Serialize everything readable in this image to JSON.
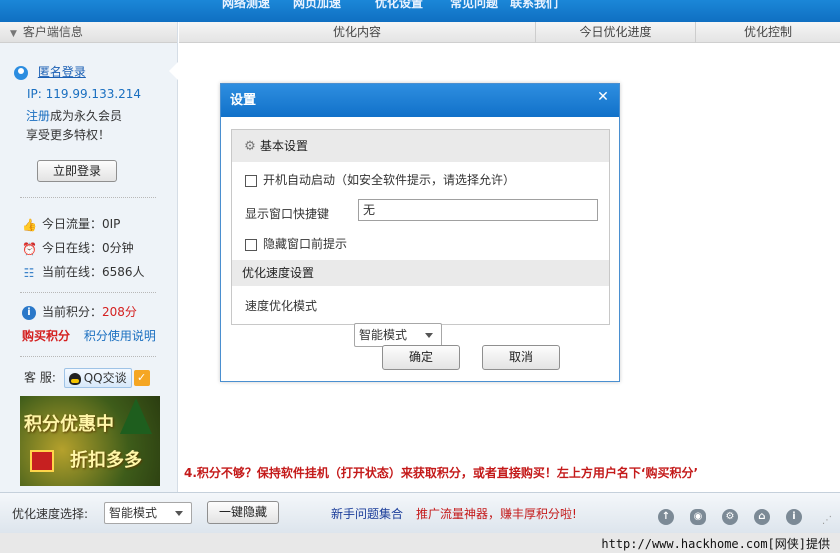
{
  "top_menu": [
    "网络测速",
    "网页加速",
    "优化设置",
    "常见问题",
    "联系我们"
  ],
  "sidebar": {
    "header": "客户端信息",
    "anon_login": "匿名登录",
    "ip": "IP: 119.99.133.214",
    "register_link": "注册",
    "register_text": "成为永久会员",
    "privilege_text": "享受更多特权！",
    "login_button": "立即登录",
    "traffic": "今日流量：0IP",
    "online_time": "今日在线：0分钟",
    "current_online": "当前在线：6586人",
    "points_label": "当前积分：",
    "points_value": "208分",
    "buy_points": "购买积分",
    "points_help": "积分使用说明",
    "service_label": "客 服:",
    "qq_label": "QQ交谈",
    "banner_line1": "积分优惠中",
    "banner_line2": "折扣多多"
  },
  "table_header": {
    "content": "优化内容",
    "progress": "今日优化进度",
    "control": "优化控制"
  },
  "tip": "4.积分不够？保持软件挂机（打开状态）来获取积分，或者直接购买！左上方用户名下‘购买积分’",
  "bottom": {
    "speed_label": "优化速度选择:",
    "speed_value": "智能模式",
    "hide_button": "一键隐藏",
    "faq_link": "新手问题集合",
    "promo_link": "推广流量神器，赚丰厚积分啦!"
  },
  "watermark": "http://www.hackhome.com[网侠]提供",
  "dialog": {
    "title": "设置",
    "close": "✕",
    "basic_section": "基本设置",
    "autostart_label": "开机自动启动（如安全软件提示，请选择允许）",
    "autostart_checked": false,
    "hotkey_label": "显示窗口快捷键",
    "hotkey_value": "无",
    "hide_tip_label": "隐藏窗口前提示",
    "hide_tip_checked": false,
    "speed_section": "优化速度设置",
    "speed_mode_label": "速度优化模式",
    "speed_mode_value": "智能模式",
    "ok": "确定",
    "cancel": "取消"
  },
  "colors": {
    "title_bar": "#1b87d8",
    "accent_red": "#d42020",
    "link_blue": "#1a6fc0"
  }
}
